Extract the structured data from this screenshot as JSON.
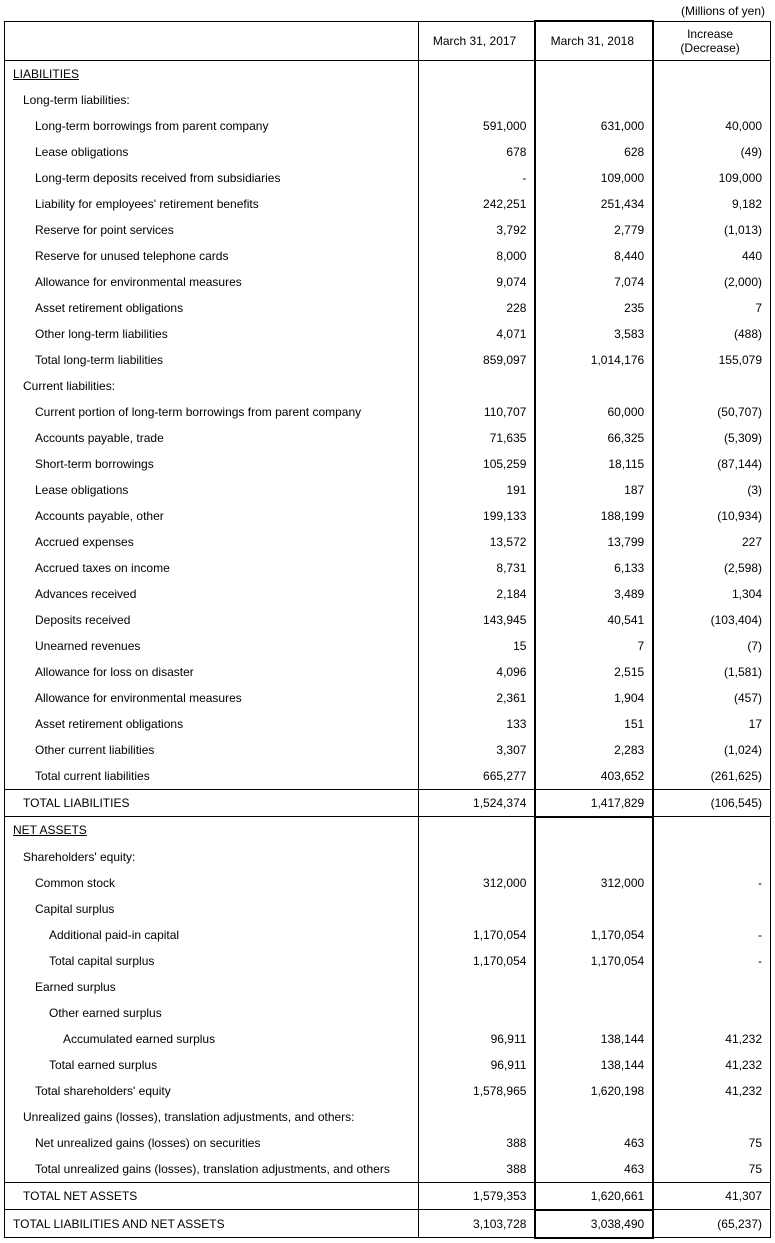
{
  "unit_label": "(Millions of yen)",
  "headers": {
    "col1": "March 31, 2017",
    "col2": "March 31, 2018",
    "col3_line1": "Increase",
    "col3_line2": "(Decrease)"
  },
  "rows": [
    {
      "type": "section",
      "label": "LIABILITIES"
    },
    {
      "type": "sub",
      "ind": 1,
      "label": "Long-term liabilities:"
    },
    {
      "type": "data",
      "ind": 2,
      "label": "Long-term borrowings from parent company",
      "v1": "591,000",
      "v2": "631,000",
      "v3": "40,000"
    },
    {
      "type": "data",
      "ind": 2,
      "label": "Lease obligations",
      "v1": "678",
      "v2": "628",
      "v3": "(49)"
    },
    {
      "type": "data",
      "ind": 2,
      "label": "Long-term deposits received from subsidiaries",
      "v1": "-",
      "v2": "109,000",
      "v3": "109,000"
    },
    {
      "type": "data",
      "ind": 2,
      "label": "Liability for employees' retirement benefits",
      "v1": "242,251",
      "v2": "251,434",
      "v3": "9,182"
    },
    {
      "type": "data",
      "ind": 2,
      "label": "Reserve for point services",
      "v1": "3,792",
      "v2": "2,779",
      "v3": "(1,013)"
    },
    {
      "type": "data",
      "ind": 2,
      "label": "Reserve for unused telephone cards",
      "v1": "8,000",
      "v2": "8,440",
      "v3": "440"
    },
    {
      "type": "data",
      "ind": 2,
      "label": "Allowance for environmental measures",
      "v1": "9,074",
      "v2": "7,074",
      "v3": "(2,000)"
    },
    {
      "type": "data",
      "ind": 2,
      "label": "Asset retirement obligations",
      "v1": "228",
      "v2": "235",
      "v3": "7"
    },
    {
      "type": "data",
      "ind": 2,
      "label": "Other long-term liabilities",
      "v1": "4,071",
      "v2": "3,583",
      "v3": "(488)"
    },
    {
      "type": "data",
      "ind": 2,
      "label": "Total long-term liabilities",
      "v1": "859,097",
      "v2": "1,014,176",
      "v3": "155,079"
    },
    {
      "type": "sub",
      "ind": 1,
      "label": "Current liabilities:"
    },
    {
      "type": "data",
      "ind": 2,
      "label": "Current portion of long-term borrowings from parent company",
      "v1": "110,707",
      "v2": "60,000",
      "v3": "(50,707)"
    },
    {
      "type": "data",
      "ind": 2,
      "label": "Accounts payable, trade",
      "v1": "71,635",
      "v2": "66,325",
      "v3": "(5,309)"
    },
    {
      "type": "data",
      "ind": 2,
      "label": "Short-term borrowings",
      "v1": "105,259",
      "v2": "18,115",
      "v3": "(87,144)"
    },
    {
      "type": "data",
      "ind": 2,
      "label": "Lease obligations",
      "v1": "191",
      "v2": "187",
      "v3": "(3)"
    },
    {
      "type": "data",
      "ind": 2,
      "label": "Accounts payable, other",
      "v1": "199,133",
      "v2": "188,199",
      "v3": "(10,934)"
    },
    {
      "type": "data",
      "ind": 2,
      "label": "Accrued expenses",
      "v1": "13,572",
      "v2": "13,799",
      "v3": "227"
    },
    {
      "type": "data",
      "ind": 2,
      "label": "Accrued taxes on income",
      "v1": "8,731",
      "v2": "6,133",
      "v3": "(2,598)"
    },
    {
      "type": "data",
      "ind": 2,
      "label": "Advances received",
      "v1": "2,184",
      "v2": "3,489",
      "v3": "1,304"
    },
    {
      "type": "data",
      "ind": 2,
      "label": "Deposits received",
      "v1": "143,945",
      "v2": "40,541",
      "v3": "(103,404)"
    },
    {
      "type": "data",
      "ind": 2,
      "label": "Unearned revenues",
      "v1": "15",
      "v2": "7",
      "v3": "(7)"
    },
    {
      "type": "data",
      "ind": 2,
      "label": "Allowance for loss on disaster",
      "v1": "4,096",
      "v2": "2,515",
      "v3": "(1,581)"
    },
    {
      "type": "data",
      "ind": 2,
      "label": "Allowance for environmental measures",
      "v1": "2,361",
      "v2": "1,904",
      "v3": "(457)"
    },
    {
      "type": "data",
      "ind": 2,
      "label": "Asset retirement obligations",
      "v1": "133",
      "v2": "151",
      "v3": "17"
    },
    {
      "type": "data",
      "ind": 2,
      "label": "Other current liabilities",
      "v1": "3,307",
      "v2": "2,283",
      "v3": "(1,024)"
    },
    {
      "type": "data",
      "ind": 2,
      "label": "Total current liabilities",
      "v1": "665,277",
      "v2": "403,652",
      "v3": "(261,625)"
    },
    {
      "type": "total",
      "ind": 1,
      "label": "TOTAL LIABILITIES",
      "v1": "1,524,374",
      "v2": "1,417,829",
      "v3": "(106,545)",
      "border": "both"
    },
    {
      "type": "section",
      "label": "NET ASSETS"
    },
    {
      "type": "sub",
      "ind": 1,
      "label": "Shareholders' equity:"
    },
    {
      "type": "data",
      "ind": 2,
      "label": "Common stock",
      "v1": "312,000",
      "v2": "312,000",
      "v3": "-"
    },
    {
      "type": "sub",
      "ind": 2,
      "label": "Capital surplus"
    },
    {
      "type": "data",
      "ind": 3,
      "label": "Additional paid-in capital",
      "v1": "1,170,054",
      "v2": "1,170,054",
      "v3": "-"
    },
    {
      "type": "data",
      "ind": 3,
      "label": "Total capital surplus",
      "v1": "1,170,054",
      "v2": "1,170,054",
      "v3": "-"
    },
    {
      "type": "sub",
      "ind": 2,
      "label": "Earned surplus"
    },
    {
      "type": "sub",
      "ind": 3,
      "label": "Other earned surplus"
    },
    {
      "type": "data",
      "ind": 4,
      "label": "Accumulated earned surplus",
      "v1": "96,911",
      "v2": "138,144",
      "v3": "41,232"
    },
    {
      "type": "data",
      "ind": 3,
      "label": "Total earned surplus",
      "v1": "96,911",
      "v2": "138,144",
      "v3": "41,232"
    },
    {
      "type": "data",
      "ind": 2,
      "label": "Total shareholders' equity",
      "v1": "1,578,965",
      "v2": "1,620,198",
      "v3": "41,232"
    },
    {
      "type": "sub",
      "ind": 1,
      "label": "Unrealized gains (losses), translation adjustments, and others:"
    },
    {
      "type": "data",
      "ind": 2,
      "label": "Net unrealized gains (losses) on securities",
      "v1": "388",
      "v2": "463",
      "v3": "75"
    },
    {
      "type": "data",
      "ind": 2,
      "label": "Total unrealized gains (losses), translation adjustments, and others",
      "v1": "388",
      "v2": "463",
      "v3": "75"
    },
    {
      "type": "total",
      "ind": 1,
      "label": "TOTAL NET ASSETS",
      "v1": "1,579,353",
      "v2": "1,620,661",
      "v3": "41,307",
      "border": "both"
    },
    {
      "type": "total",
      "ind": 0,
      "label": "TOTAL LIABILITIES AND NET ASSETS",
      "v1": "3,103,728",
      "v2": "3,038,490",
      "v3": "(65,237)",
      "border": "bottom"
    }
  ]
}
